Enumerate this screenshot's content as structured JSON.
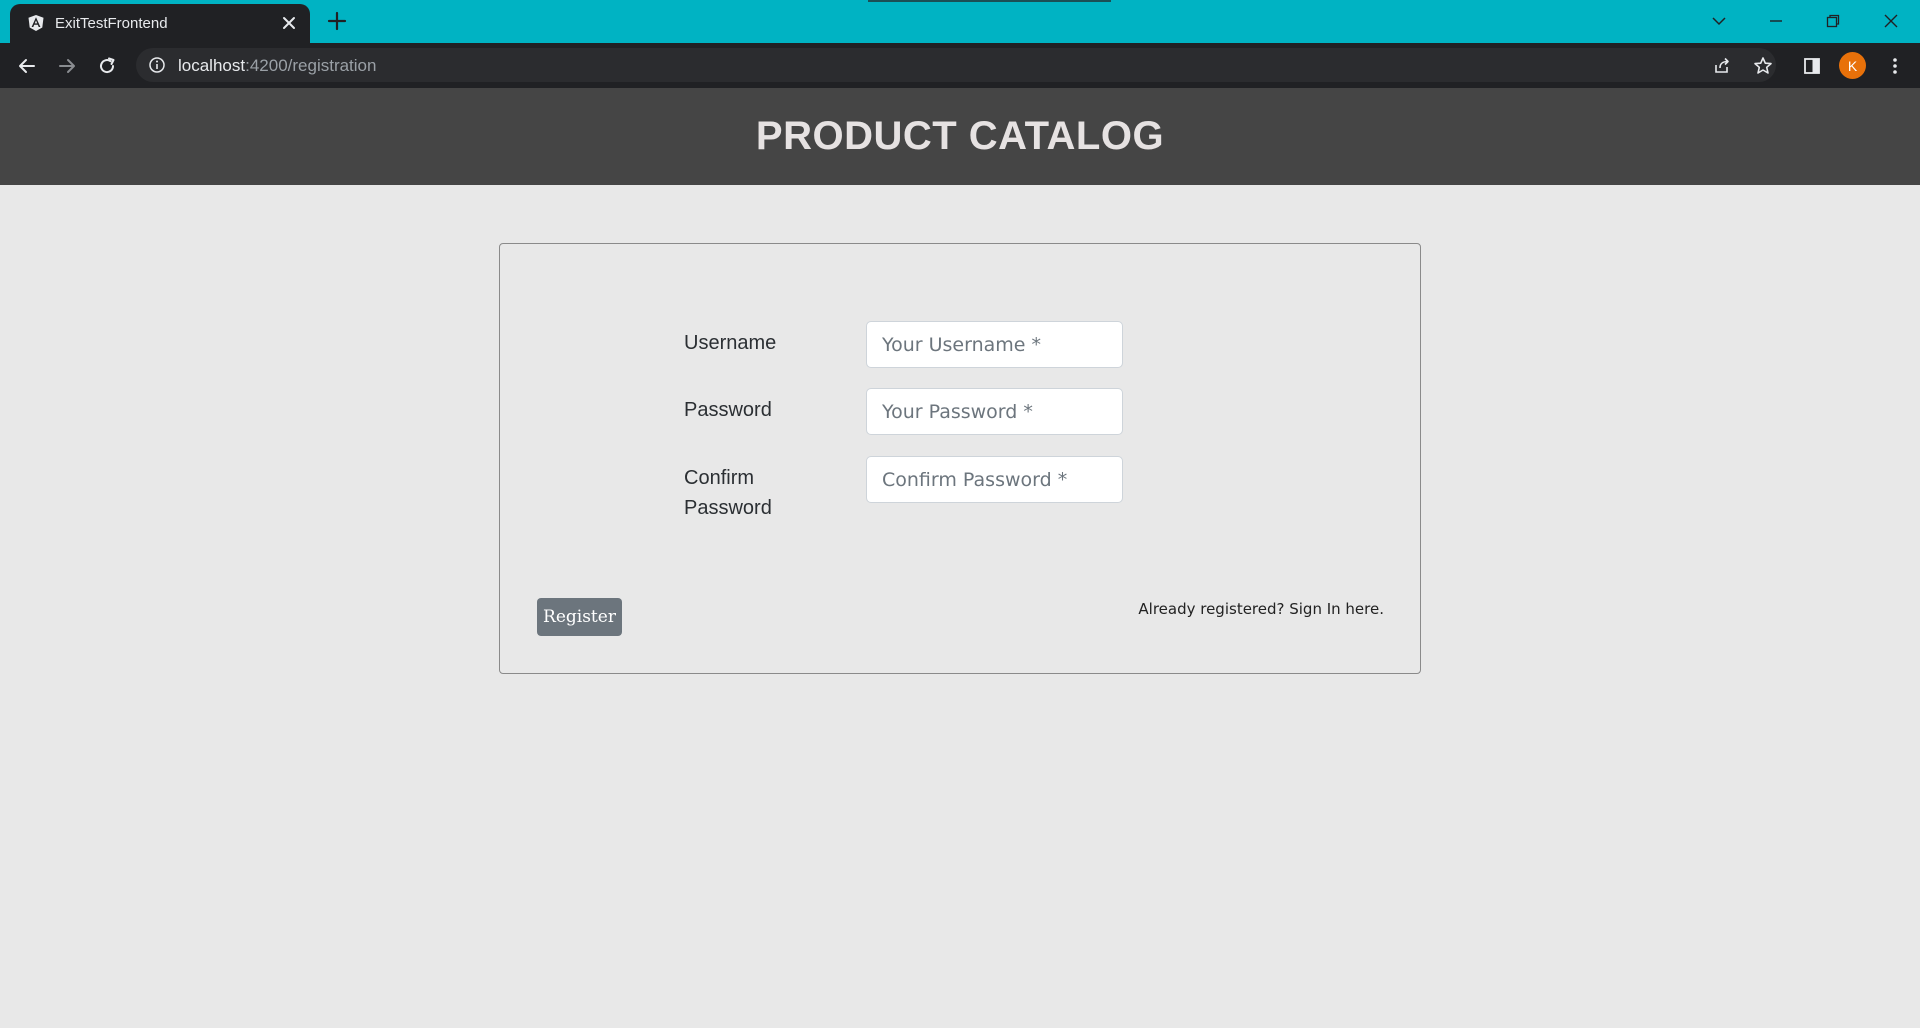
{
  "browser": {
    "tab": {
      "title": "ExitTestFrontend",
      "favicon": "angular-logo-icon"
    },
    "address_bar": {
      "host": "localhost",
      "path": ":4200/registration"
    },
    "profile_initial": "K",
    "colors": {
      "tabstrip": "#00b3c3",
      "toolbar": "#202124",
      "avatar": "#e8710a"
    }
  },
  "header": {
    "title": "PRODUCT CATALOG",
    "background": "#454545"
  },
  "form": {
    "username": {
      "label": "Username",
      "placeholder": "Your Username *"
    },
    "password": {
      "label": "Password",
      "placeholder": "Your Password *"
    },
    "confirm_password": {
      "label": "Confirm Password",
      "placeholder": "Confirm Password *"
    },
    "register_label": "Register",
    "signin_text": "Already registered? Sign In here."
  }
}
